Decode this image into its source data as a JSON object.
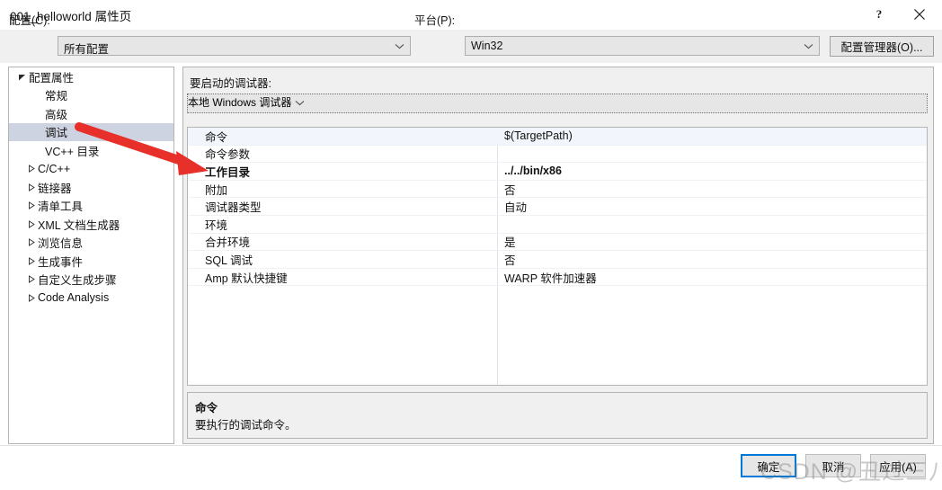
{
  "window": {
    "title": "001_helloworld 属性页",
    "help_icon": "question-mark-icon",
    "close_icon": "close-icon"
  },
  "config_bar": {
    "config_label": "配置(C):",
    "config_value": "所有配置",
    "platform_label": "平台(P):",
    "platform_value": "Win32",
    "config_manager_button": "配置管理器(O)...",
    "dropdown_icon": "chevron-down-icon"
  },
  "tree": {
    "items": [
      {
        "label": "配置属性",
        "depth": 0,
        "expander": "expanded",
        "selected": false
      },
      {
        "label": "常规",
        "depth": 1,
        "expander": "none",
        "selected": false
      },
      {
        "label": "高级",
        "depth": 1,
        "expander": "none",
        "selected": false
      },
      {
        "label": "调试",
        "depth": 1,
        "expander": "none",
        "selected": true
      },
      {
        "label": "VC++ 目录",
        "depth": 1,
        "expander": "none",
        "selected": false
      },
      {
        "label": "C/C++",
        "depth": 1,
        "expander": "collapsed",
        "selected": false
      },
      {
        "label": "链接器",
        "depth": 1,
        "expander": "collapsed",
        "selected": false
      },
      {
        "label": "清单工具",
        "depth": 1,
        "expander": "collapsed",
        "selected": false
      },
      {
        "label": "XML 文档生成器",
        "depth": 1,
        "expander": "collapsed",
        "selected": false
      },
      {
        "label": "浏览信息",
        "depth": 1,
        "expander": "collapsed",
        "selected": false
      },
      {
        "label": "生成事件",
        "depth": 1,
        "expander": "collapsed",
        "selected": false
      },
      {
        "label": "自定义生成步骤",
        "depth": 1,
        "expander": "collapsed",
        "selected": false
      },
      {
        "label": "Code Analysis",
        "depth": 1,
        "expander": "collapsed",
        "selected": false
      }
    ]
  },
  "content": {
    "debugger_label": "要启动的调试器:",
    "debugger_value": "本地 Windows 调试器",
    "properties": [
      {
        "name": "命令",
        "value": "$(TargetPath)",
        "selected": true,
        "bold": false
      },
      {
        "name": "命令参数",
        "value": "",
        "selected": false,
        "bold": false
      },
      {
        "name": "工作目录",
        "value": "../../bin/x86",
        "selected": false,
        "bold": true
      },
      {
        "name": "附加",
        "value": "否",
        "selected": false,
        "bold": false
      },
      {
        "name": "调试器类型",
        "value": "自动",
        "selected": false,
        "bold": false
      },
      {
        "name": "环境",
        "value": "",
        "selected": false,
        "bold": false
      },
      {
        "name": "合并环境",
        "value": "是",
        "selected": false,
        "bold": false
      },
      {
        "name": "SQL 调试",
        "value": "否",
        "selected": false,
        "bold": false
      },
      {
        "name": "Amp 默认快捷键",
        "value": "WARP 软件加速器",
        "selected": false,
        "bold": false
      }
    ],
    "description": {
      "title": "命令",
      "body": "要执行的调试命令。"
    }
  },
  "footer": {
    "ok": "确定",
    "cancel": "取消",
    "apply": "应用(A)"
  },
  "annotation": {
    "arrow_color": "#e8302a",
    "arrow_name": "red-pointer-arrow"
  },
  "watermark": {
    "text": "CSDN @丑过三八线"
  }
}
